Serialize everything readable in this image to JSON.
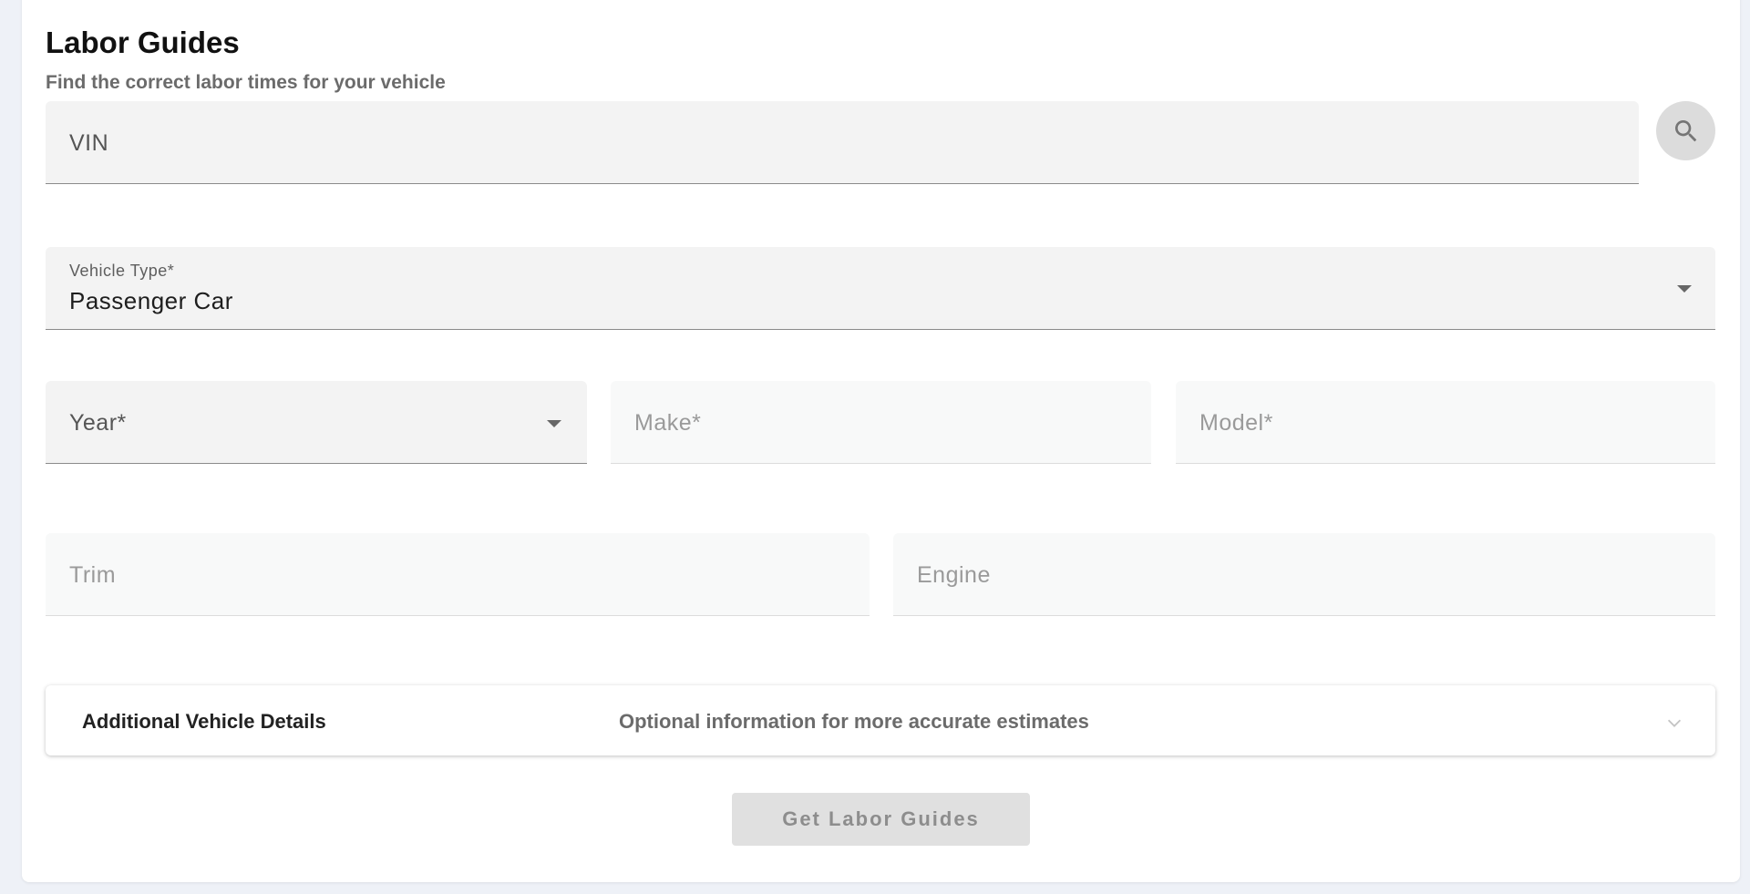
{
  "header": {
    "title": "Labor Guides",
    "subtitle": "Find the correct labor times for your vehicle"
  },
  "vin": {
    "placeholder": "VIN"
  },
  "search_button": {
    "icon": "search-icon"
  },
  "vehicle_type": {
    "label": "Vehicle Type*",
    "value": "Passenger Car"
  },
  "year": {
    "label": "Year*"
  },
  "make": {
    "label": "Make*"
  },
  "model": {
    "label": "Model*"
  },
  "trim": {
    "label": "Trim"
  },
  "engine": {
    "label": "Engine"
  },
  "additional_details": {
    "title": "Additional Vehicle Details",
    "subtitle": "Optional information for more accurate estimates"
  },
  "submit": {
    "label": "Get Labor Guides"
  },
  "colors": {
    "page_background": "#eef1f7",
    "field_background": "#f3f3f3",
    "disabled_field_background": "#f8f9f9",
    "button_disabled": "#e0e0e0"
  }
}
